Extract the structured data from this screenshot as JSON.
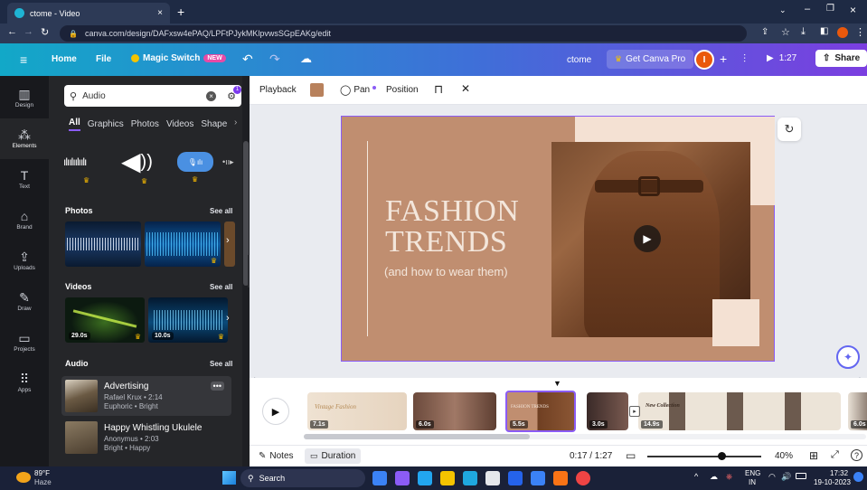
{
  "browser": {
    "tab_title": "ctome - Video",
    "url": "canva.com/design/DAFxsw4ePAQ/LPFtPJykMKlpvwsSGpEAKg/edit"
  },
  "header": {
    "home": "Home",
    "file": "File",
    "magic_switch": "Magic Switch",
    "magic_badge": "NEW",
    "doc_name": "ctome",
    "get_pro": "Get Canva Pro",
    "avatar_letter": "I",
    "play_time": "1:27",
    "share": "Share"
  },
  "rail": [
    {
      "label": "Design",
      "icon": "▥"
    },
    {
      "label": "Elements",
      "icon": "⁂"
    },
    {
      "label": "Text",
      "icon": "T"
    },
    {
      "label": "Brand",
      "icon": "⌂"
    },
    {
      "label": "Uploads",
      "icon": "⇪"
    },
    {
      "label": "Draw",
      "icon": "✎"
    },
    {
      "label": "Projects",
      "icon": "▭"
    },
    {
      "label": "Apps",
      "icon": "⠿"
    }
  ],
  "panel": {
    "search_value": "Audio",
    "filter_count": "1",
    "categories": [
      "All",
      "Graphics",
      "Photos",
      "Videos",
      "Shape"
    ],
    "photos_title": "Photos",
    "videos_title": "Videos",
    "audio_title": "Audio",
    "see_all": "See all",
    "video_durations": [
      "29.0s",
      "10.0s"
    ],
    "audio": [
      {
        "title": "Advertising",
        "artist": "Rafael Krux • 2:14",
        "tags": "Euphoric • Bright"
      },
      {
        "title": "Happy Whistling Ukulele",
        "artist": "Anonymus • 2:03",
        "tags": "Bright • Happy"
      }
    ]
  },
  "toolbar": {
    "playback": "Playback",
    "pan": "Pan",
    "position": "Position"
  },
  "canvas": {
    "headline_1": "FASHION",
    "headline_2": "TRENDS",
    "subline": "(and how to wear them)"
  },
  "timeline": {
    "clips": [
      {
        "duration": "7.1s",
        "label": "Vintage Fashion"
      },
      {
        "duration": "6.0s",
        "label": ""
      },
      {
        "duration": "5.5s",
        "label": "FASHION TRENDS"
      },
      {
        "duration": "3.0s",
        "label": ""
      },
      {
        "duration": "14.9s",
        "label": "New Collection"
      },
      {
        "duration": "6.0s",
        "label": ""
      }
    ]
  },
  "bottombar": {
    "notes": "Notes",
    "duration": "Duration",
    "time": "0:17 / 1:27",
    "zoom": "40%",
    "zoom_value": 0.65
  },
  "taskbar": {
    "temp": "89°F",
    "weather": "Haze",
    "search": "Search",
    "lang_1": "ENG",
    "lang_2": "IN",
    "clock": "17:32",
    "date": "19-10-2023"
  },
  "colors": {
    "accent": "#8b5cf6",
    "canvas_bg": "#c08e70",
    "canvas_light": "#f4e1d3",
    "header_start": "#12a8c8",
    "header_end": "#7b3ee0"
  }
}
